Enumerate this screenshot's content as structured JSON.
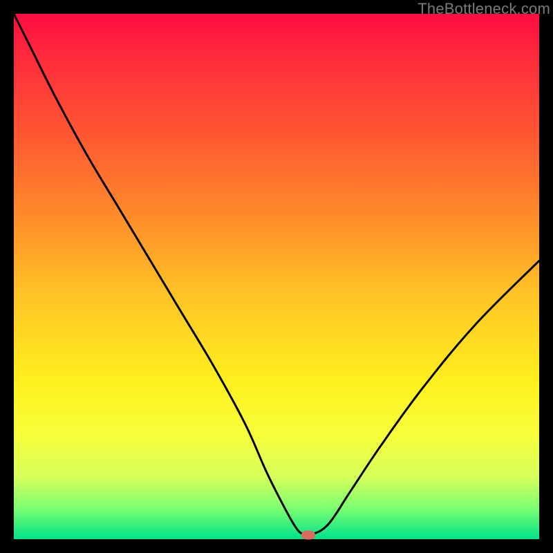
{
  "watermark": "TheBottleneck.com",
  "chart_data": {
    "type": "line",
    "title": "",
    "xlabel": "",
    "ylabel": "",
    "xlim": [
      0,
      100
    ],
    "ylim": [
      0,
      100
    ],
    "grid": false,
    "legend": false,
    "series": [
      {
        "name": "bottleneck-curve",
        "x": [
          0,
          3,
          8,
          14,
          20,
          26,
          32,
          38,
          44,
          48,
          51,
          53.5,
          55,
          57,
          60,
          64,
          70,
          78,
          88,
          100
        ],
        "y": [
          100,
          94,
          84,
          73,
          63,
          53,
          43,
          33,
          22,
          13,
          7,
          2.5,
          1,
          1,
          3,
          9,
          18,
          29,
          41,
          53
        ]
      }
    ],
    "annotations": [
      {
        "name": "min-marker",
        "x": 56,
        "y": 0.8,
        "color": "#d86a5f"
      }
    ],
    "background_gradient_hint": "red-top-to-green-bottom"
  }
}
